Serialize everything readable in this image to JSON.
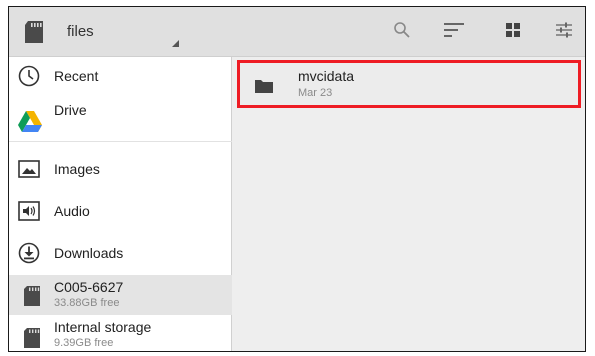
{
  "toolbar": {
    "root_title": "files",
    "icons": [
      "search-icon",
      "sort-icon",
      "grid-view-icon",
      "settings-sliders-icon"
    ]
  },
  "sidebar": {
    "items": [
      {
        "label": "Recent",
        "icon": "clock-icon"
      },
      {
        "label": "Drive",
        "icon": "drive-icon"
      },
      {
        "label": "Images",
        "icon": "image-icon"
      },
      {
        "label": "Audio",
        "icon": "audio-icon"
      },
      {
        "label": "Downloads",
        "icon": "download-icon"
      },
      {
        "label": "C005-6627",
        "sub": "33.88GB free",
        "icon": "sd-card-icon",
        "selected": true
      },
      {
        "label": "Internal storage",
        "sub": "9.39GB free",
        "icon": "sd-card-icon"
      }
    ]
  },
  "content": {
    "documents": [
      {
        "name": "mvcidata",
        "date": "Mar 23",
        "icon": "folder-icon"
      }
    ]
  },
  "colors": {
    "highlight_border": "#ee1c24",
    "drive_green": "#0f9d58",
    "drive_yellow": "#f4b400",
    "drive_blue": "#4285f4"
  }
}
